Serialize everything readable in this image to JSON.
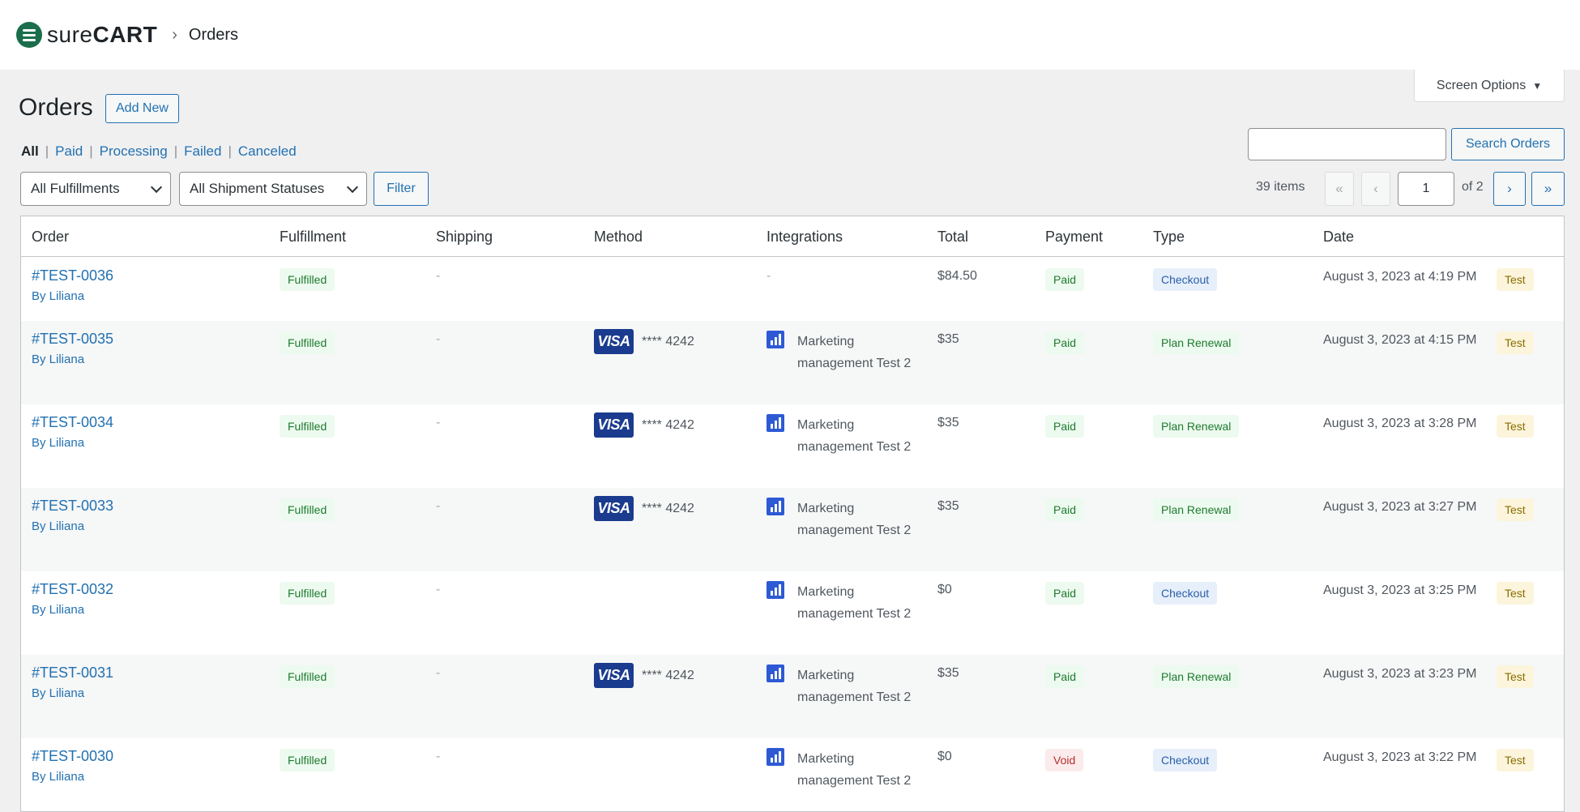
{
  "brand": {
    "name_part1": "sure",
    "name_part2": "CART"
  },
  "breadcrumb": {
    "separator": "›",
    "current": "Orders"
  },
  "screen_options": {
    "label": "Screen Options",
    "arrow": "▼"
  },
  "page": {
    "title": "Orders",
    "add_new": "Add New"
  },
  "views": [
    {
      "label": "All",
      "current": true
    },
    {
      "label": "Paid",
      "current": false
    },
    {
      "label": "Processing",
      "current": false
    },
    {
      "label": "Failed",
      "current": false
    },
    {
      "label": "Canceled",
      "current": false
    }
  ],
  "filters": {
    "fulfillment": "All Fulfillments",
    "shipment": "All Shipment Statuses",
    "filter_button": "Filter"
  },
  "search": {
    "value": "",
    "button": "Search Orders"
  },
  "pagination": {
    "items": "39 items",
    "first": "«",
    "prev": "‹",
    "current": "1",
    "of": "of 2",
    "next": "›",
    "last": "»"
  },
  "columns": [
    "Order",
    "Fulfillment",
    "Shipping",
    "Method",
    "Integrations",
    "Total",
    "Payment",
    "Type",
    "Date"
  ],
  "rows": [
    {
      "order": "#TEST-0036",
      "by": "By Liliana",
      "fulfillment": "Fulfilled",
      "shipping": "-",
      "method": "",
      "card": "",
      "integration": "-",
      "total": "$84.50",
      "payment": "Paid",
      "type": "Checkout",
      "date": "August 3, 2023 at 4:19 PM",
      "mode": "Test"
    },
    {
      "order": "#TEST-0035",
      "by": "By Liliana",
      "fulfillment": "Fulfilled",
      "shipping": "-",
      "method": "VISA",
      "card": "**** 4242",
      "integration": "Marketing management Test 2",
      "total": "$35",
      "payment": "Paid",
      "type": "Plan Renewal",
      "date": "August 3, 2023 at 4:15 PM",
      "mode": "Test"
    },
    {
      "order": "#TEST-0034",
      "by": "By Liliana",
      "fulfillment": "Fulfilled",
      "shipping": "-",
      "method": "VISA",
      "card": "**** 4242",
      "integration": "Marketing management Test 2",
      "total": "$35",
      "payment": "Paid",
      "type": "Plan Renewal",
      "date": "August 3, 2023 at 3:28 PM",
      "mode": "Test"
    },
    {
      "order": "#TEST-0033",
      "by": "By Liliana",
      "fulfillment": "Fulfilled",
      "shipping": "-",
      "method": "VISA",
      "card": "**** 4242",
      "integration": "Marketing management Test 2",
      "total": "$35",
      "payment": "Paid",
      "type": "Plan Renewal",
      "date": "August 3, 2023 at 3:27 PM",
      "mode": "Test"
    },
    {
      "order": "#TEST-0032",
      "by": "By Liliana",
      "fulfillment": "Fulfilled",
      "shipping": "-",
      "method": "",
      "card": "",
      "integration": "Marketing management Test 2",
      "total": "$0",
      "payment": "Paid",
      "type": "Checkout",
      "date": "August 3, 2023 at 3:25 PM",
      "mode": "Test"
    },
    {
      "order": "#TEST-0031",
      "by": "By Liliana",
      "fulfillment": "Fulfilled",
      "shipping": "-",
      "method": "VISA",
      "card": "**** 4242",
      "integration": "Marketing management Test 2",
      "total": "$35",
      "payment": "Paid",
      "type": "Plan Renewal",
      "date": "August 3, 2023 at 3:23 PM",
      "mode": "Test"
    },
    {
      "order": "#TEST-0030",
      "by": "By Liliana",
      "fulfillment": "Fulfilled",
      "shipping": "-",
      "method": "",
      "card": "",
      "integration": "Marketing management Test 2",
      "total": "$0",
      "payment": "Void",
      "type": "Checkout",
      "date": "August 3, 2023 at 3:22 PM",
      "mode": "Test"
    }
  ],
  "colors": {
    "brand": "#1a6e4b",
    "link": "#2271b1",
    "paid_bg": "#edfaef",
    "void_bg": "#fcebec",
    "checkout_bg": "#e6effa",
    "test_bg": "#fcf5dc",
    "visa": "#1a3b8e",
    "integration_icon": "#2d5ad4"
  },
  "icons": {
    "logo": "surecart-logo-icon",
    "card": "visa-card-icon",
    "integration": "bar-chart-icon",
    "dropdown": "chevron-down-icon"
  }
}
